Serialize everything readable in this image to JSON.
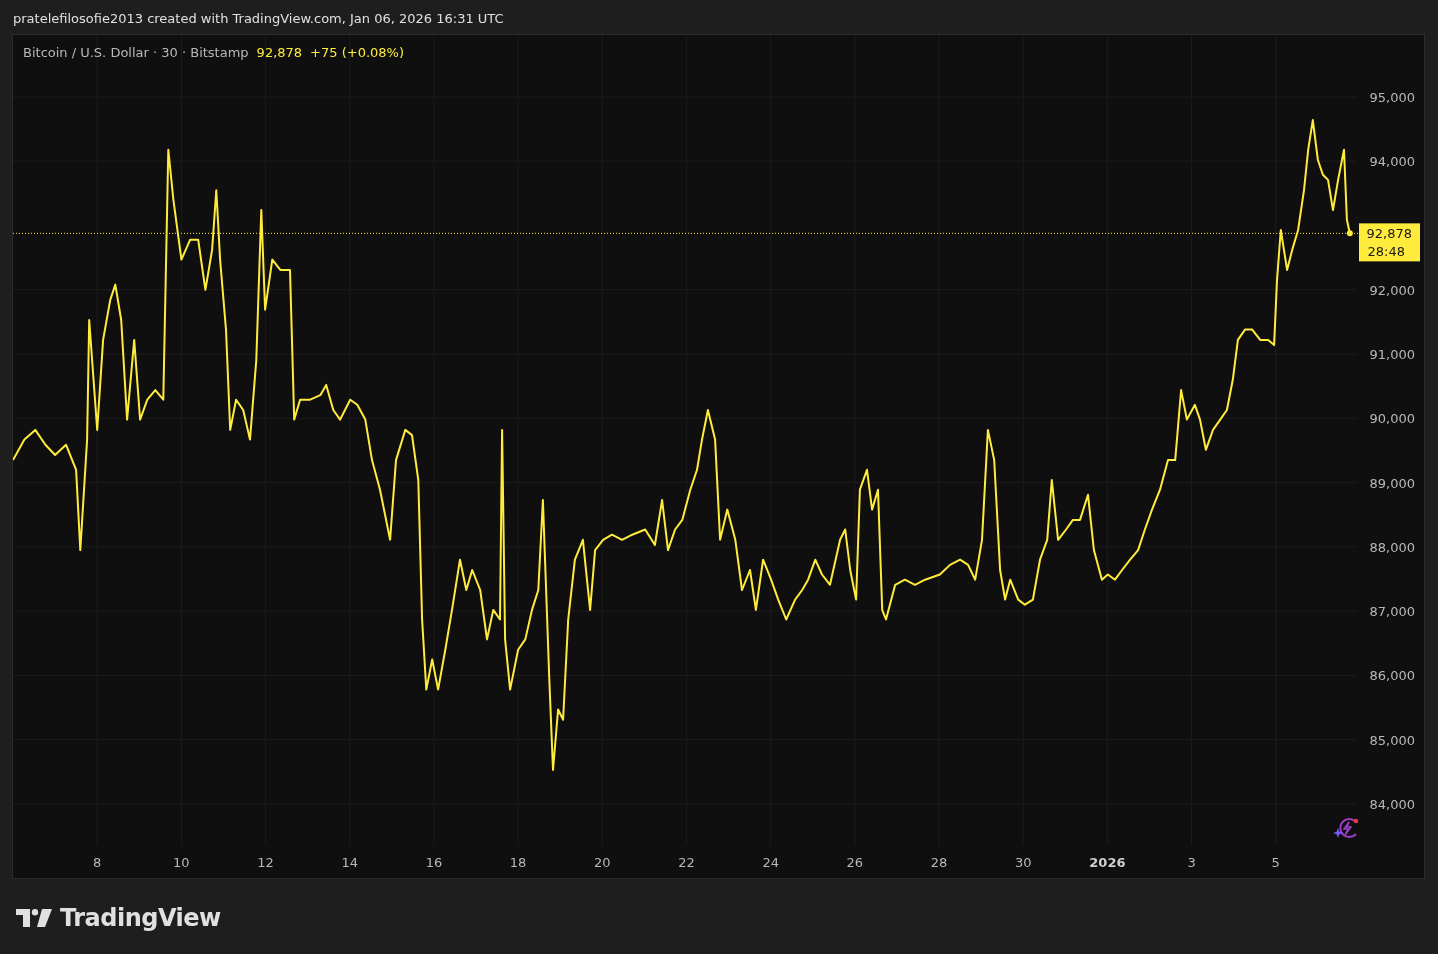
{
  "caption": "pratelefilosofie2013 created with TradingView.com, Jan 06, 2026 16:31 UTC",
  "legend": {
    "symbol": "Bitcoin / U.S. Dollar · 30 · Bitstamp",
    "price": "92,878",
    "change": "+75 (+0.08%)"
  },
  "chart_data": {
    "type": "line",
    "x": [
      6.0,
      6.27,
      6.53,
      6.77,
      7.0,
      7.26,
      7.5,
      7.6,
      7.76,
      7.81,
      8.0,
      8.14,
      8.31,
      8.43,
      8.57,
      8.71,
      8.88,
      9.02,
      9.19,
      9.38,
      9.57,
      9.69,
      9.81,
      10.0,
      10.21,
      10.4,
      10.57,
      10.73,
      10.83,
      10.92,
      11.06,
      11.16,
      11.3,
      11.47,
      11.63,
      11.78,
      11.9,
      11.99,
      12.16,
      12.35,
      12.58,
      12.68,
      12.82,
      13.06,
      13.3,
      13.44,
      13.61,
      13.77,
      14.01,
      14.18,
      14.37,
      14.53,
      14.72,
      14.96,
      15.1,
      15.32,
      15.48,
      15.63,
      15.72,
      15.82,
      15.96,
      16.1,
      16.27,
      16.43,
      16.62,
      16.77,
      16.91,
      17.1,
      17.26,
      17.41,
      17.57,
      17.62,
      17.69,
      17.81,
      18.0,
      18.17,
      18.33,
      18.48,
      18.59,
      18.74,
      18.83,
      18.95,
      19.07,
      19.19,
      19.35,
      19.54,
      19.71,
      19.83,
      20.02,
      20.23,
      20.47,
      20.71,
      21.02,
      21.25,
      21.42,
      21.56,
      21.73,
      21.9,
      22.09,
      22.25,
      22.37,
      22.51,
      22.68,
      22.8,
      22.97,
      23.16,
      23.32,
      23.51,
      23.65,
      23.82,
      24.01,
      24.18,
      24.37,
      24.58,
      24.75,
      24.89,
      25.06,
      25.22,
      25.41,
      25.65,
      25.77,
      25.89,
      26.03,
      26.12,
      26.29,
      26.41,
      26.55,
      26.65,
      26.74,
      26.96,
      27.19,
      27.43,
      27.67,
      28.02,
      28.26,
      28.5,
      28.69,
      28.86,
      29.02,
      29.16,
      29.31,
      29.45,
      29.57,
      29.69,
      29.88,
      30.04,
      30.23,
      30.4,
      30.57,
      30.68,
      30.83,
      31.02,
      31.18,
      31.35,
      31.54,
      31.68,
      31.87,
      32.01,
      32.18,
      32.35,
      32.54,
      32.73,
      32.89,
      33.06,
      33.25,
      33.44,
      33.61,
      33.75,
      33.89,
      34.08,
      34.2,
      34.34,
      34.51,
      34.68,
      34.84,
      34.98,
      35.1,
      35.27,
      35.44,
      35.63,
      35.82,
      35.96,
      36.03,
      36.12,
      36.27,
      36.39,
      36.53,
      36.67,
      36.77,
      36.88,
      37.0,
      37.12,
      37.24,
      37.36,
      37.48,
      37.62,
      37.69,
      37.76
    ],
    "series": [
      {
        "color": "#ffeb3b",
        "values": [
          89350,
          89670,
          89820,
          89590,
          89430,
          89590,
          89200,
          87950,
          89670,
          91530,
          89820,
          91220,
          91840,
          92080,
          91530,
          89980,
          91220,
          89980,
          90290,
          90440,
          90290,
          94180,
          93400,
          92470,
          92780,
          92780,
          92000,
          92620,
          93550,
          92470,
          91380,
          89820,
          90290,
          90130,
          89670,
          90910,
          93240,
          91690,
          92470,
          92310,
          92310,
          89980,
          90290,
          90290,
          90360,
          90520,
          90130,
          89980,
          90290,
          90210,
          89980,
          89350,
          88890,
          88110,
          89350,
          89820,
          89740,
          89040,
          86870,
          85780,
          86250,
          85780,
          86400,
          87020,
          87800,
          87330,
          87640,
          87330,
          86560,
          87020,
          86870,
          89820,
          86560,
          85780,
          86400,
          86560,
          87020,
          87330,
          88730,
          85940,
          84530,
          85470,
          85310,
          86870,
          87800,
          88110,
          87020,
          87950,
          88110,
          88190,
          88110,
          88190,
          88270,
          88030,
          88730,
          87950,
          88270,
          88420,
          88890,
          89200,
          89670,
          90130,
          89670,
          88110,
          88580,
          88110,
          87330,
          87640,
          87020,
          87800,
          87490,
          87180,
          86870,
          87180,
          87330,
          87490,
          87800,
          87570,
          87410,
          88110,
          88270,
          87640,
          87180,
          88890,
          89200,
          88580,
          88890,
          87020,
          86870,
          87410,
          87490,
          87410,
          87490,
          87570,
          87720,
          87800,
          87720,
          87490,
          88110,
          89820,
          89350,
          87640,
          87180,
          87490,
          87180,
          87100,
          87180,
          87800,
          88110,
          89040,
          88110,
          88270,
          88420,
          88420,
          88810,
          87950,
          87490,
          87570,
          87490,
          87640,
          87800,
          87950,
          88270,
          88580,
          88890,
          89350,
          89350,
          90440,
          89980,
          90210,
          89980,
          89510,
          89820,
          89980,
          90130,
          90600,
          91220,
          91380,
          91380,
          91220,
          91220,
          91140,
          92150,
          92930,
          92310,
          92620,
          92930,
          93550,
          94180,
          94640,
          94020,
          93790,
          93710,
          93240,
          93710,
          94180,
          93090,
          92880
        ]
      }
    ],
    "xlim": [
      6.0,
      37.93
    ],
    "ylim": [
      83362,
      95964
    ],
    "xticks": [
      8,
      10,
      12,
      14,
      16,
      18,
      20,
      22,
      24,
      26,
      28,
      30
    ],
    "grid": true,
    "yticks": [
      {
        "value": 84000,
        "label": "84,000"
      },
      {
        "value": 85000,
        "label": "85,000"
      },
      {
        "value": 86000,
        "label": "86,000"
      },
      {
        "value": 87000,
        "label": "87,000"
      },
      {
        "value": 88000,
        "label": "88,000"
      },
      {
        "value": 89000,
        "label": "89,000"
      },
      {
        "value": 90000,
        "label": "90,000"
      },
      {
        "value": 91000,
        "label": "91,000"
      },
      {
        "value": 92000,
        "label": "92,000"
      },
      {
        "value": 94000,
        "label": "94,000"
      },
      {
        "value": 95000,
        "label": "95,000"
      }
    ],
    "ref_lines": [
      {
        "axis": "y",
        "value": 92878,
        "label": "92,878",
        "color": "#ffeb3b"
      }
    ]
  },
  "time_axis": {
    "ticks": [
      {
        "label": "2026",
        "bold": true
      },
      {
        "label": "3",
        "bold": false
      },
      {
        "label": "5",
        "bold": false
      }
    ]
  },
  "price_tag": {
    "countdown": "28:48"
  },
  "footer": {
    "brand": "TradingView"
  }
}
